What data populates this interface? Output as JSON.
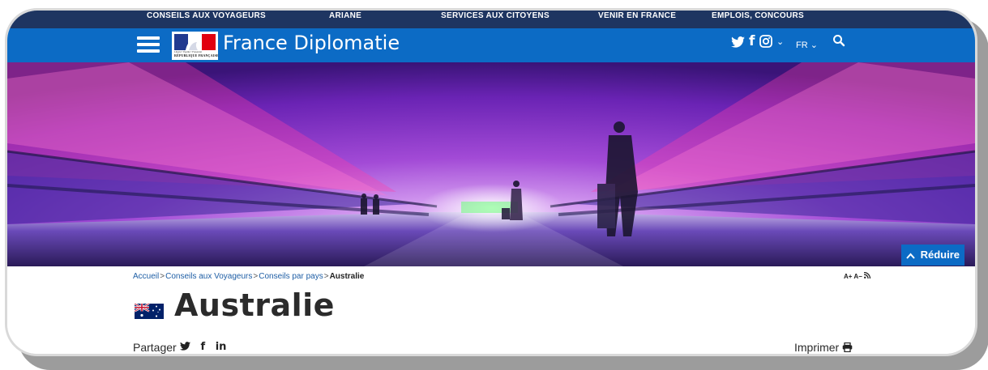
{
  "top_nav": {
    "items": [
      "CONSEILS AUX VOYAGEURS",
      "ARIANE",
      "SERVICES AUX CITOYENS",
      "VENIR EN FRANCE",
      "EMPLOIS, CONCOURS"
    ]
  },
  "header": {
    "site_title": "France Diplomatie",
    "logo_motto": "Liberté • Égalité • Fraternité",
    "logo_text": "RÉPUBLIQUE FRANÇAISE",
    "social_icons": [
      "twitter-icon",
      "facebook-icon",
      "instagram-icon"
    ],
    "social_more": "⌄",
    "language": "FR",
    "language_chevron": "⌄",
    "search_icon": "search-icon"
  },
  "banner": {
    "reduce_label": "Réduire",
    "reduce_icon": "chevron-up-icon"
  },
  "breadcrumb": {
    "items": [
      "Accueil",
      "Conseils aux Voyageurs",
      "Conseils par pays"
    ],
    "separator": ">",
    "current": "Australie"
  },
  "tools": {
    "increase_font": "A+",
    "decrease_font": "A−",
    "rss_icon": "rss-icon"
  },
  "page": {
    "title": "Australie",
    "flag_icon": "australia-flag-icon"
  },
  "share": {
    "label": "Partager",
    "icons": [
      "twitter-icon",
      "facebook-icon",
      "linkedin-icon"
    ],
    "facebook_glyph": "f",
    "linkedin_glyph": "in"
  },
  "print": {
    "label": "Imprimer",
    "icon": "printer-icon"
  },
  "colors": {
    "top_nav_bg": "#1e3561",
    "header_bg": "#0c6bc5",
    "link": "#1e5ea5",
    "title_text": "#2b2b2b"
  }
}
